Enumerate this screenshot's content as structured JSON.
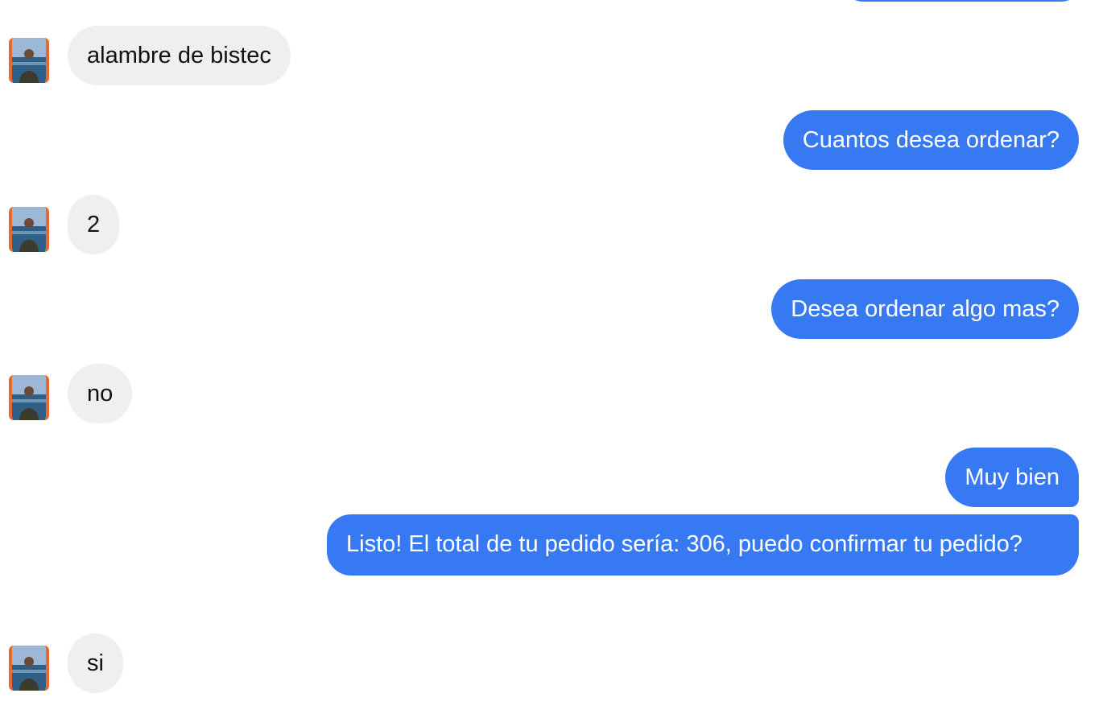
{
  "colors": {
    "bot_bubble": "#3679f3",
    "user_bubble": "#efefef",
    "user_text": "#111111",
    "bot_text": "#ffffff",
    "avatar_border": "#e8692e"
  },
  "messages": [
    {
      "from": "user",
      "text": "alambre de bistec",
      "avatar_icon": "user-avatar-icon"
    },
    {
      "from": "bot",
      "text": "Cuantos desea ordenar?"
    },
    {
      "from": "user",
      "text": "2",
      "avatar_icon": "user-avatar-icon"
    },
    {
      "from": "bot",
      "text": "Desea ordenar algo mas?"
    },
    {
      "from": "user",
      "text": "no",
      "avatar_icon": "user-avatar-icon"
    },
    {
      "from": "bot",
      "text": "Muy bien"
    },
    {
      "from": "bot",
      "text": "Listo! El total de tu pedido sería: 306, puedo confirmar tu pedido?"
    },
    {
      "from": "user",
      "text": "si",
      "avatar_icon": "user-avatar-icon"
    }
  ]
}
